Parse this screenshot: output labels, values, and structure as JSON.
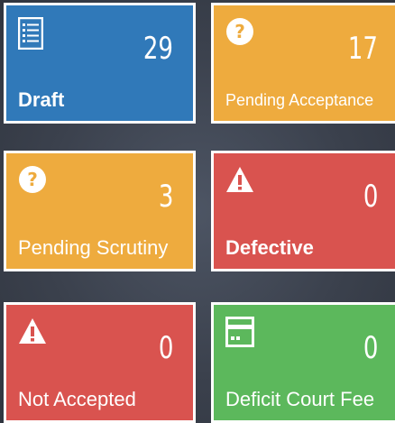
{
  "tiles": [
    {
      "id": "draft",
      "label": "Draft",
      "count": "29",
      "icon": "list-document-icon",
      "color": "#3079b9"
    },
    {
      "id": "pending-acceptance",
      "label": "Pending Acceptance",
      "count": "17",
      "icon": "question-circle-icon",
      "color": "#eeab3e"
    },
    {
      "id": "pending-scrutiny",
      "label": "Pending Scrutiny",
      "count": "3",
      "icon": "question-circle-icon",
      "color": "#eeab3e"
    },
    {
      "id": "defective",
      "label": "Defective",
      "count": "0",
      "icon": "warning-triangle-icon",
      "color": "#d9534f"
    },
    {
      "id": "not-accepted",
      "label": "Not Accepted",
      "count": "0",
      "icon": "warning-triangle-icon",
      "color": "#d9534f"
    },
    {
      "id": "deficit-court-fee",
      "label": "Deficit Court Fee",
      "count": "0",
      "icon": "credit-card-icon",
      "color": "#5cb85c"
    }
  ]
}
